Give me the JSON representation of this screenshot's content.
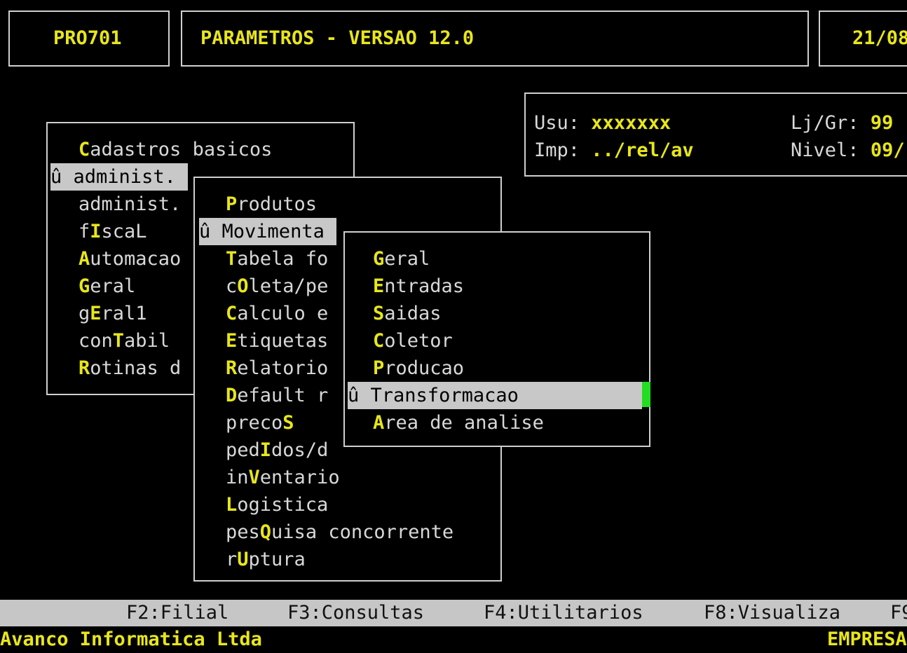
{
  "header": {
    "program_code": "PRO701",
    "title": "PARAMETROS - VERSAO 12.0",
    "date": "21/08"
  },
  "info": {
    "user_label": "Usu:",
    "user_value": "xxxxxxx",
    "group_label": "Lj/Gr:",
    "group_value": "99",
    "printer_label": "Imp:",
    "printer_value": "../rel/av",
    "level_label": "Nivel:",
    "level_value": "09/"
  },
  "menu1": {
    "items": [
      {
        "pre": "",
        "hot": "C",
        "post": "adastros basicos",
        "selected": false
      },
      {
        "pre": "administ.",
        "hot": "",
        "post": "",
        "selected": true,
        "marker": "û"
      },
      {
        "pre": "administ.",
        "hot": "",
        "post": "",
        "selected": false
      },
      {
        "pre": "f",
        "hot": "I",
        "post": "scaL",
        "selected": false
      },
      {
        "pre": "",
        "hot": "A",
        "post": "utomacao",
        "selected": false
      },
      {
        "pre": "",
        "hot": "G",
        "post": "eral",
        "selected": false
      },
      {
        "pre": "g",
        "hot": "E",
        "post": "ral1",
        "selected": false
      },
      {
        "pre": "con",
        "hot": "T",
        "post": "abil",
        "selected": false
      },
      {
        "pre": "",
        "hot": "R",
        "post": "otinas d",
        "selected": false
      }
    ]
  },
  "menu2": {
    "items": [
      {
        "pre": "",
        "hot": "P",
        "post": "rodutos",
        "selected": false
      },
      {
        "pre": "Movimenta",
        "hot": "",
        "post": "",
        "selected": true,
        "marker": "û"
      },
      {
        "pre": "",
        "hot": "T",
        "post": "abela fo",
        "selected": false
      },
      {
        "pre": "c",
        "hot": "O",
        "post": "leta/pe",
        "selected": false
      },
      {
        "pre": "",
        "hot": "C",
        "post": "alculo e",
        "selected": false
      },
      {
        "pre": "",
        "hot": "E",
        "post": "tiquetas",
        "selected": false
      },
      {
        "pre": "",
        "hot": "R",
        "post": "elatorio",
        "selected": false
      },
      {
        "pre": "",
        "hot": "D",
        "post": "efault r",
        "selected": false
      },
      {
        "pre": "preco",
        "hot": "S",
        "post": "",
        "selected": false
      },
      {
        "pre": "ped",
        "hot": "I",
        "post": "dos/d",
        "selected": false
      },
      {
        "pre": "in",
        "hot": "V",
        "post": "entario",
        "selected": false
      },
      {
        "pre": "",
        "hot": "L",
        "post": "ogistica",
        "selected": false
      },
      {
        "pre": "pes",
        "hot": "Q",
        "post": "uisa concorrente",
        "selected": false
      },
      {
        "pre": "r",
        "hot": "U",
        "post": "ptura",
        "selected": false
      }
    ]
  },
  "menu3": {
    "items": [
      {
        "pre": "",
        "hot": "G",
        "post": "eral",
        "selected": false
      },
      {
        "pre": "",
        "hot": "E",
        "post": "ntradas",
        "selected": false
      },
      {
        "pre": "",
        "hot": "S",
        "post": "aidas",
        "selected": false
      },
      {
        "pre": "",
        "hot": "C",
        "post": "oletor",
        "selected": false
      },
      {
        "pre": "",
        "hot": "P",
        "post": "roducao",
        "selected": false
      },
      {
        "pre": "Transformacao",
        "hot": "",
        "post": "",
        "selected": true,
        "marker": "û"
      },
      {
        "pre": "",
        "hot": "A",
        "post": "rea de analise",
        "selected": false
      }
    ]
  },
  "function_keys": [
    "F2:Filial",
    "F3:Consultas",
    "F4:Utilitarios",
    "F8:Visualiza",
    "F9"
  ],
  "footer": {
    "company": "Avanco Informatica Ltda",
    "right": "EMPRESA"
  }
}
